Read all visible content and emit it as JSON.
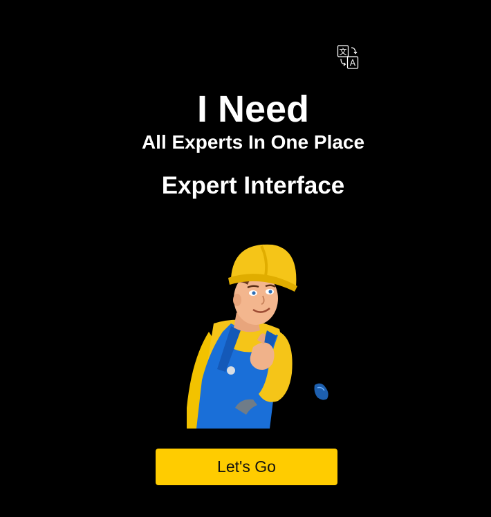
{
  "header": {
    "translate_icon": "translate-icon"
  },
  "hero": {
    "headline": "I Need",
    "tagline": "All Experts In One Place",
    "interface_title": "Expert Interface"
  },
  "illustration": {
    "subject": "worker-mascot",
    "accent_icon": "glove-icon"
  },
  "actions": {
    "go_label": "Let's Go"
  },
  "colors": {
    "background": "#000000",
    "text": "#ffffff",
    "button": "#ffcc00",
    "button_text": "#111111",
    "helmet": "#f5c518",
    "overalls": "#1a6fd8"
  }
}
